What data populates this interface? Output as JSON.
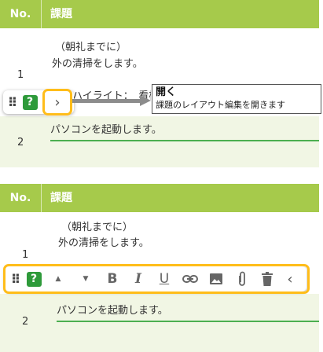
{
  "table": {
    "header_no": "No.",
    "header_title": "課題",
    "row1": {
      "num": "1",
      "line1": "（朝礼までに）",
      "line2": "外の清掃をします。",
      "line3": "ハイライト：　看板"
    },
    "row2": {
      "num": "2",
      "text": "パソコンを起動します。"
    }
  },
  "top_toolbar": {
    "grip_icon": "drag-handle",
    "help_icon": "?",
    "expand_glyph": "›"
  },
  "tooltip": {
    "title": "開く",
    "description": "課題のレイアウト編集を開きます"
  },
  "bottom_toolbar": {
    "grip_icon": "drag-handle",
    "help_icon": "?",
    "up_glyph": "▲",
    "down_glyph": "▼",
    "bold_glyph": "B",
    "italic_glyph": "I",
    "underline_glyph": "U",
    "collapse_glyph": "‹"
  },
  "colors": {
    "header_bg": "#a6ca4b",
    "highlight": "#ffbd1a",
    "help_green": "#2e9a3a",
    "input_underline": "#4caf50",
    "row_alt_bg": "#f1f6e4"
  }
}
